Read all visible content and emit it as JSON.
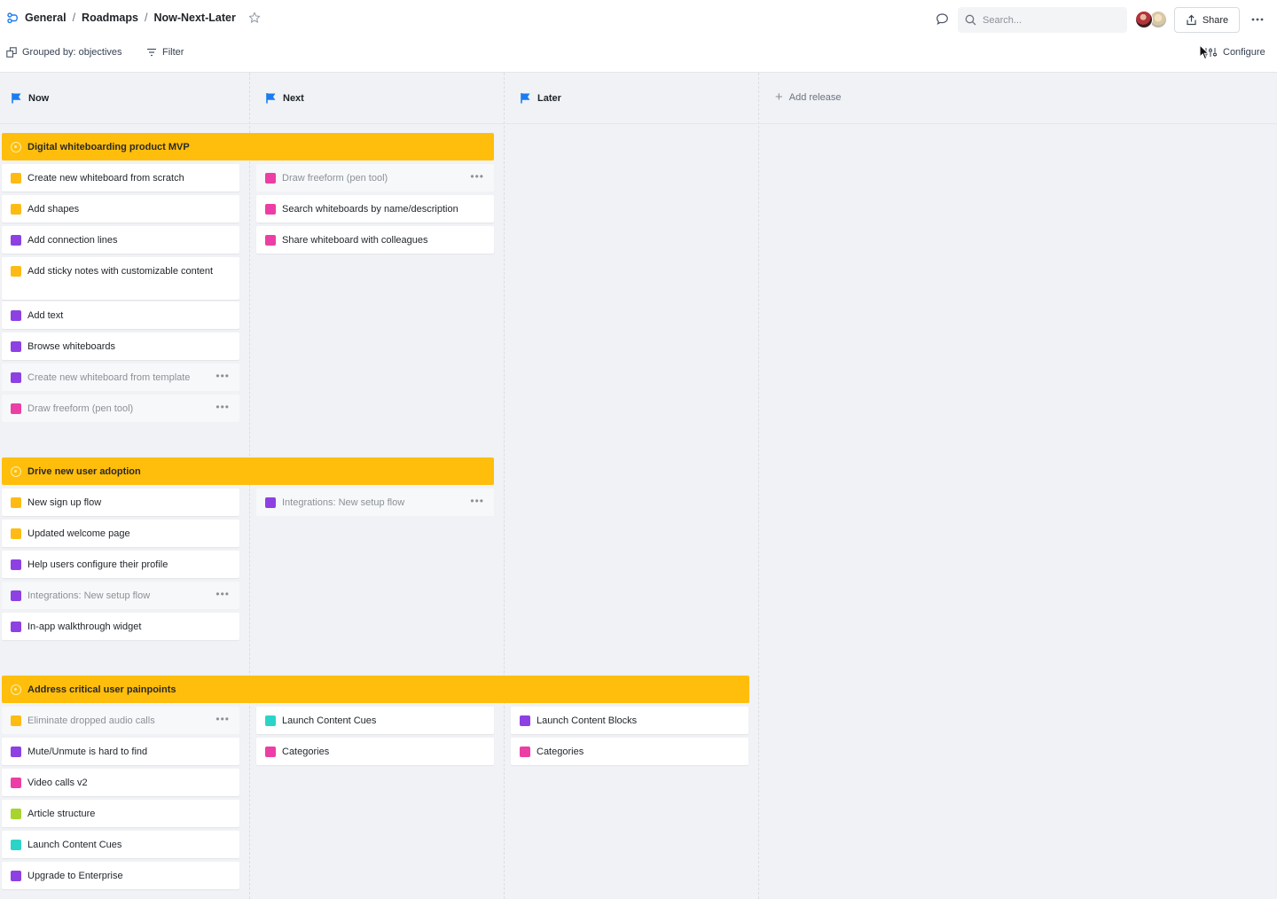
{
  "breadcrumbs": [
    "General",
    "Roadmaps",
    "Now-Next-Later"
  ],
  "header": {
    "search_placeholder": "Search...",
    "share_label": "Share"
  },
  "toolbar": {
    "group_label": "Grouped by: objectives",
    "filter_label": "Filter",
    "configure_label": "Configure"
  },
  "columns": {
    "now": "Now",
    "next": "Next",
    "later": "Later",
    "add_release": "Add release"
  },
  "colors": {
    "objective": "#ffbe0b",
    "yellow": "#fdbb14",
    "purple": "#8d41e3",
    "pink": "#ec3fa5",
    "teal": "#2cd4c8",
    "lime": "#a7d431",
    "flag": "#1b7cf0"
  },
  "objectives": [
    {
      "title": "Digital whiteboarding product MVP",
      "now": [
        {
          "label": "Create new whiteboard from scratch",
          "color": "yellow"
        },
        {
          "label": "Add shapes",
          "color": "yellow"
        },
        {
          "label": "Add connection lines",
          "color": "purple"
        },
        {
          "label": "Add sticky notes with customizable content",
          "color": "yellow"
        },
        {
          "label": "Add text",
          "color": "purple"
        },
        {
          "label": "Browse whiteboards",
          "color": "purple"
        },
        {
          "label": "Create new whiteboard from template",
          "color": "purple"
        },
        {
          "label": "Draw freeform (pen tool)",
          "color": "pink"
        }
      ],
      "next": [
        {
          "label": "Draw freeform (pen tool)",
          "color": "pink"
        },
        {
          "label": "Search whiteboards by name/description",
          "color": "pink"
        },
        {
          "label": "Share whiteboard with colleagues",
          "color": "pink"
        }
      ]
    },
    {
      "title": "Drive new user adoption",
      "now": [
        {
          "label": "New sign up flow",
          "color": "yellow"
        },
        {
          "label": "Updated welcome page",
          "color": "yellow"
        },
        {
          "label": "Help users configure their profile",
          "color": "purple"
        },
        {
          "label": "Integrations: New setup flow",
          "color": "purple"
        },
        {
          "label": "In-app walkthrough widget",
          "color": "purple"
        }
      ],
      "next": [
        {
          "label": "Integrations: New setup flow",
          "color": "purple"
        }
      ]
    },
    {
      "title": "Address critical user painpoints",
      "now": [
        {
          "label": "Eliminate dropped audio calls",
          "color": "yellow"
        },
        {
          "label": "Mute/Unmute is hard to find",
          "color": "purple"
        },
        {
          "label": "Video calls v2",
          "color": "pink"
        },
        {
          "label": "Article structure",
          "color": "lime"
        },
        {
          "label": "Launch Content Cues",
          "color": "teal"
        },
        {
          "label": "Upgrade to Enterprise",
          "color": "purple"
        }
      ],
      "next": [
        {
          "label": "Launch Content Cues",
          "color": "teal"
        },
        {
          "label": "Categories",
          "color": "pink"
        }
      ],
      "later": [
        {
          "label": "Launch Content Blocks",
          "color": "purple"
        },
        {
          "label": "Categories",
          "color": "pink"
        }
      ]
    }
  ]
}
